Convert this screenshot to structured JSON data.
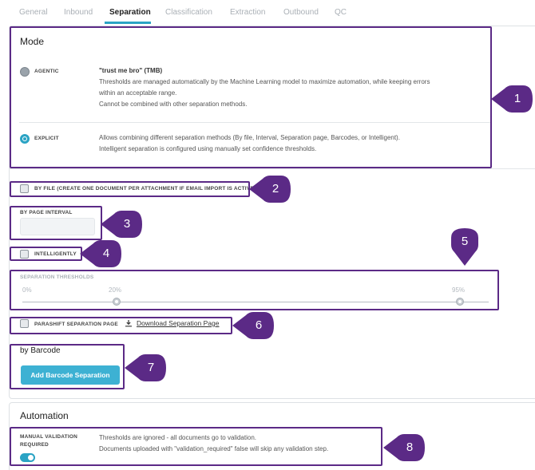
{
  "tabs": [
    "General",
    "Inbound",
    "Separation",
    "Classification",
    "Extraction",
    "Outbound",
    "QC"
  ],
  "mode": {
    "title": "Mode",
    "agentic": {
      "label": "AGENTIC",
      "heading": "\"trust me bro\" (TMB)",
      "line1": "Thresholds are managed automatically by the Machine Learning model to maximize automation, while keeping errors",
      "line2": "within an acceptable range.",
      "line3": "Cannot be combined with other separation methods."
    },
    "explicit": {
      "label": "EXPLICIT",
      "line1": "Allows combining different separation methods (By file, Interval, Separation page, Barcodes, or Intelligent).",
      "line2": "Intelligent separation is configured using manually set confidence thresholds."
    },
    "selected": "explicit"
  },
  "by_file": {
    "label": "BY FILE (CREATE ONE DOCUMENT PER ATTACHMENT IF EMAIL IMPORT IS ACTIVE)",
    "checked": false
  },
  "page_interval": {
    "label": "BY PAGE INTERVAL",
    "value": ""
  },
  "intelligently": {
    "label": "INTELLIGENTLY",
    "checked": false
  },
  "thresholds": {
    "label": "SEPARATION THRESHOLDS",
    "min_label": "0%",
    "low_label": "20%",
    "high_label": "95%",
    "low": 20,
    "high": 95
  },
  "parashift_page": {
    "label": "PARASHIFT SEPARATION PAGE",
    "download_label": "Download Separation Page",
    "checked": false
  },
  "barcode": {
    "title": "by Barcode",
    "button": "Add Barcode Separation"
  },
  "automation": {
    "title": "Automation",
    "manual_label_line1": "MANUAL VALIDATION",
    "manual_label_line2": "REQUIRED",
    "enabled": true,
    "line1": "Thresholds are ignored - all documents go to validation.",
    "line2": "Documents uploaded with \"validation_required\" false will skip any validation step."
  },
  "callouts": [
    "1",
    "2",
    "3",
    "4",
    "5",
    "6",
    "7",
    "8"
  ],
  "colors": {
    "highlight": "#5b2a86",
    "accent": "#2aa3c4",
    "button": "#3db1d3"
  }
}
